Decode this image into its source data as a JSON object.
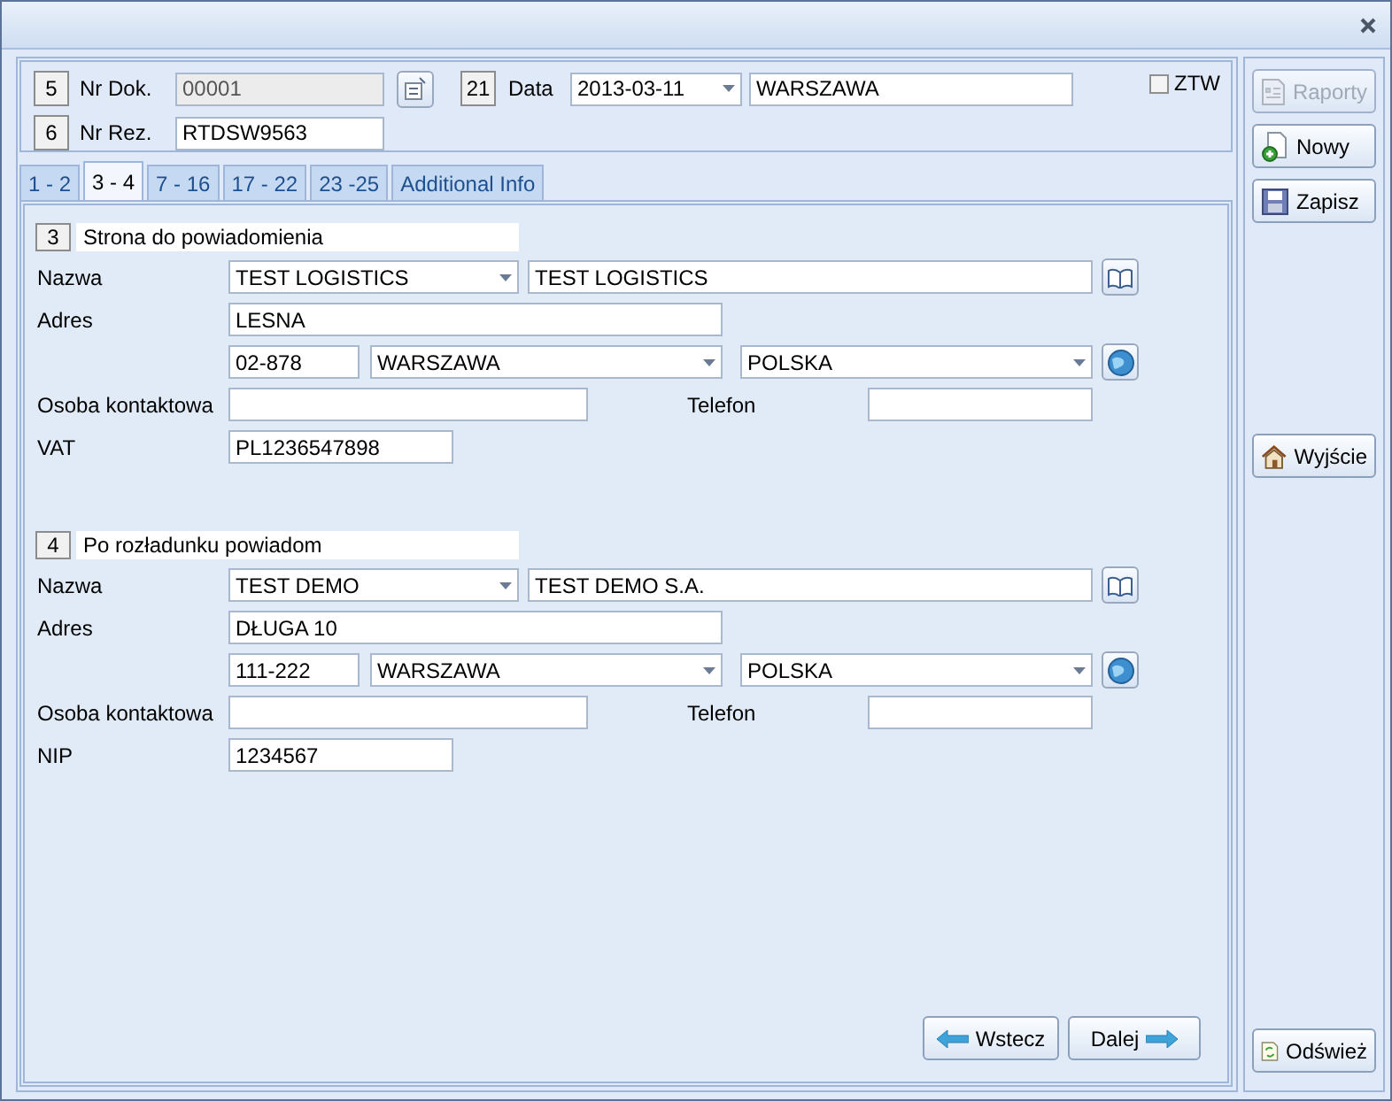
{
  "header": {
    "doc_number": {
      "badge": "5",
      "label": "Nr Dok.",
      "value": "00001",
      "disabled": true
    },
    "reservation": {
      "badge": "6",
      "label": "Nr Rez.",
      "value": "RTDSW9563"
    },
    "date": {
      "badge": "21",
      "label": "Data",
      "value": "2013-03-11"
    },
    "place": {
      "value": "WARSZAWA"
    },
    "ztw": {
      "label": "ZTW",
      "checked": false
    }
  },
  "tabs": [
    {
      "label": "1 - 2",
      "selected": false
    },
    {
      "label": "3 - 4",
      "selected": true
    },
    {
      "label": "7 - 16",
      "selected": false
    },
    {
      "label": "17 - 22",
      "selected": false
    },
    {
      "label": "23 -25",
      "selected": false
    },
    {
      "label": "Additional Info",
      "selected": false
    }
  ],
  "sections": [
    {
      "badge": "3",
      "title": "Strona do powiadomienia",
      "name_label": "Nazwa",
      "name_code": "TEST LOGISTICS",
      "name_value": "TEST LOGISTICS",
      "address_label": "Adres",
      "address": "LESNA",
      "postal_code": "02-878",
      "city": "WARSZAWA",
      "country": "POLSKA",
      "contact_label": "Osoba kontaktowa",
      "phone_label": "Telefon",
      "tax_label": "VAT",
      "tax_value": "PL1236547898"
    },
    {
      "badge": "4",
      "title": "Po rozładunku powiadom",
      "name_label": "Nazwa",
      "name_code": "TEST DEMO",
      "name_value": "TEST DEMO S.A.",
      "address_label": "Adres",
      "address": "DŁUGA 10",
      "postal_code": "111-222",
      "city": "WARSZAWA",
      "country": "POLSKA",
      "contact_label": "Osoba kontaktowa",
      "phone_label": "Telefon",
      "tax_label": "NIP",
      "tax_value": "1234567"
    }
  ],
  "nav_buttons": [
    {
      "label": "Wstecz",
      "kind": "back"
    },
    {
      "label": "Dalej",
      "kind": "next"
    }
  ],
  "sidebar": {
    "top_buttons": [
      {
        "label": "Raporty",
        "kind": "reports",
        "disabled": true
      },
      {
        "label": "Nowy",
        "kind": "new",
        "disabled": false
      },
      {
        "label": "Zapisz",
        "kind": "save",
        "disabled": false
      }
    ],
    "middle_buttons": [
      {
        "label": "Wyjście",
        "kind": "exit",
        "disabled": false
      }
    ],
    "bottom_buttons": [
      {
        "label": "Odśwież",
        "kind": "refresh",
        "disabled": false
      }
    ]
  }
}
